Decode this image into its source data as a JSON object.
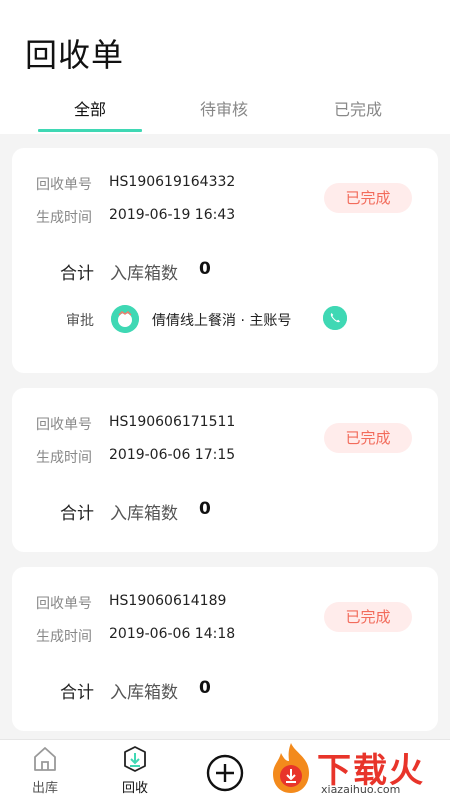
{
  "header": {
    "title": "回收单"
  },
  "tabs": [
    {
      "label": "全部",
      "active": true
    },
    {
      "label": "待审核",
      "active": false
    },
    {
      "label": "已完成",
      "active": false
    }
  ],
  "colors": {
    "accent": "#3fd8b4",
    "badge_bg": "#ffeceb",
    "badge_text": "#f26b5b"
  },
  "orders": [
    {
      "no_label": "回收单号",
      "no": "HS190619164332",
      "time_label": "生成时间",
      "time": "2019-06-19 16:43",
      "status": "已完成",
      "total_label": "合计",
      "in_label": "入库箱数",
      "count": "0",
      "approve_label": "审批",
      "approver": "倩倩线上餐消 · 主账号"
    },
    {
      "no_label": "回收单号",
      "no": "HS190606171511",
      "time_label": "生成时间",
      "time": "2019-06-06 17:15",
      "status": "已完成",
      "total_label": "合计",
      "in_label": "入库箱数",
      "count": "0"
    },
    {
      "no_label": "回收单号",
      "no": "HS19060614189",
      "time_label": "生成时间",
      "time": "2019-06-06 14:18",
      "status": "已完成",
      "total_label": "合计",
      "in_label": "入库箱数",
      "count": "0"
    }
  ],
  "bottom_nav": [
    {
      "label": "出库",
      "icon": "house-icon"
    },
    {
      "label": "回收",
      "icon": "recycle-box-icon",
      "active": true
    },
    {
      "label": "",
      "icon": "plus-circle-icon"
    }
  ],
  "watermark": {
    "text": "下载火",
    "sub": "xiazaihuo.com"
  }
}
